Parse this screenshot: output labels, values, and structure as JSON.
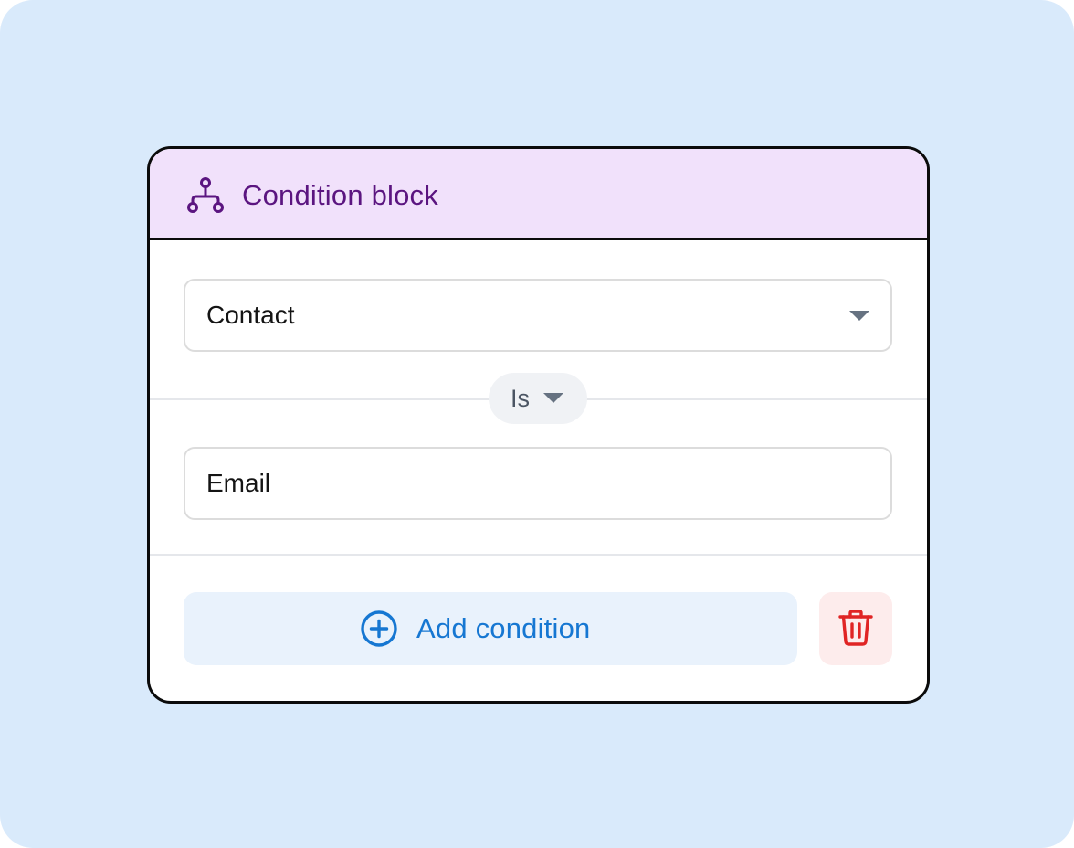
{
  "block": {
    "title": "Condition block",
    "header_icon": "flow-branch-icon",
    "accent_color": "#5b1580",
    "header_background": "#f1e1fb"
  },
  "condition": {
    "field_value": "Contact",
    "operator_value": "Is",
    "comparison_value": "Email"
  },
  "actions": {
    "add_label": "Add condition",
    "add_icon": "plus-circle-icon",
    "add_color": "#1677d2",
    "delete_icon": "trash-icon",
    "delete_color": "#e02424"
  }
}
